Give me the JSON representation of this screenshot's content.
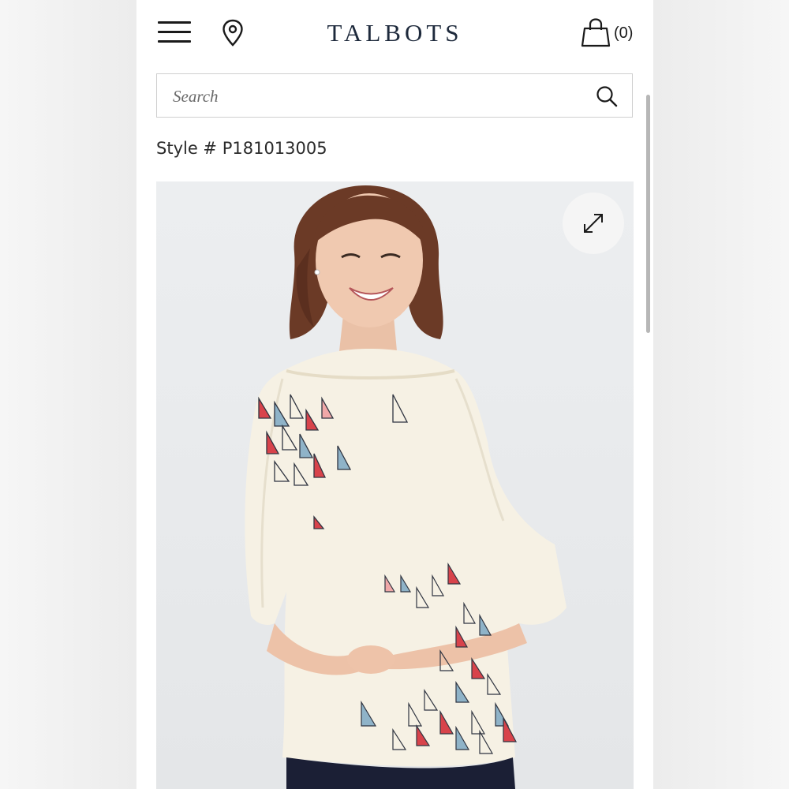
{
  "header": {
    "logo": "TALBOTS",
    "cart_count": "(0)"
  },
  "search": {
    "placeholder": "Search"
  },
  "product": {
    "style_number": "Style # P181013005",
    "image_alt": "Woman wearing cream long-sleeve boat-neck top with sailboat print"
  },
  "icons": {
    "menu": "hamburger-menu-icon",
    "location": "map-pin-icon",
    "bag": "shopping-bag-icon",
    "search": "magnifier-icon",
    "expand": "expand-arrows-icon"
  },
  "colors": {
    "logo": "#1e2a3c",
    "top": "#f6f1e4",
    "sail_red": "#d8434b",
    "sail_blue": "#8fb3c8",
    "pants": "#1b1f35",
    "hair": "#6b3a26"
  }
}
